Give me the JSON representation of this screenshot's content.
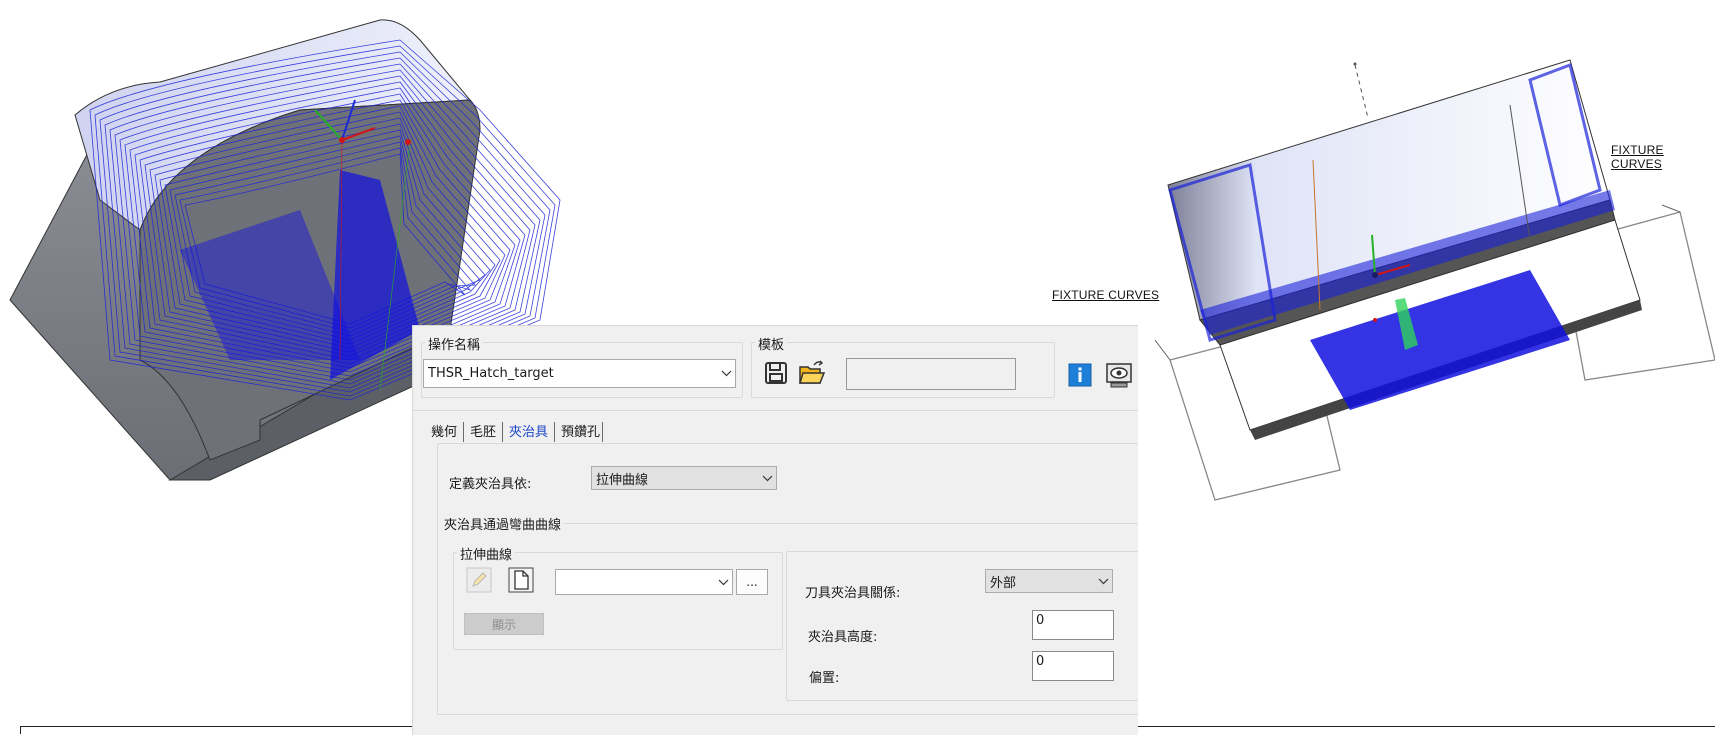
{
  "fixture_labels": {
    "left": "FIXTURE CURVES",
    "right": "FIXTURE CURVES"
  },
  "dialog": {
    "operation_name_label": "操作名稱",
    "operation_name_value": "THSR_Hatch_target",
    "template_label": "模板",
    "template_value": "",
    "tabs": [
      {
        "label": "幾何",
        "active": false
      },
      {
        "label": "毛胚",
        "active": false
      },
      {
        "label": "夾治具",
        "active": true
      },
      {
        "label": "預鑽孔",
        "active": false
      }
    ],
    "define_fixture_label": "定義夾治具依:",
    "define_fixture_value": "拉伸曲線",
    "fixture_curve_section_label": "夾治具通過彎曲曲線",
    "extrude_curve_label": "拉伸曲線",
    "curve_select_value": "",
    "ellipsis_label": "...",
    "show_button_label": "顯示",
    "tool_fixture_relation_label": "刀具夾治具關係:",
    "tool_fixture_relation_value": "外部",
    "fixture_height_label": "夾治具高度:",
    "fixture_height_value": "0",
    "offset_label": "偏置:",
    "offset_value": "0"
  },
  "icons": [
    "save-icon",
    "open-folder-icon",
    "info-icon",
    "preview-icon",
    "edit-pencil-icon",
    "document-icon",
    "chevron-down-icon"
  ],
  "colors": {
    "toolpath_blue": "#1010e0",
    "active_tab": "#1b46c7",
    "info_blue": "#1e7fd8",
    "folder_yellow": "#f3b51c"
  }
}
